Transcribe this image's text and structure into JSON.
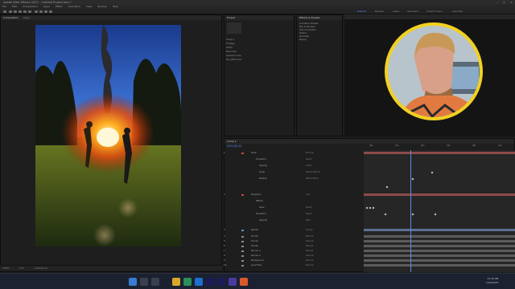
{
  "window": {
    "title": "Adobe After Effects 2023 - Untitled Project.aep *"
  },
  "menu": [
    "File",
    "Edit",
    "Composition",
    "Layer",
    "Effect",
    "Animation",
    "View",
    "Window",
    "Help"
  ],
  "workspaces": [
    "Default",
    "Review",
    "Learn",
    "Standard",
    "Small Screen",
    "Libraries"
  ],
  "comp_panel": {
    "tab": "Composition",
    "tab2": "Layer",
    "zoom": "100%",
    "resolution": "Full",
    "timecode": "0;00;04;12"
  },
  "project_panel": {
    "tab": "Project",
    "items": [
      "Comp 1",
      "Footage",
      "Solids",
      "Precomps",
      "explosion.mov",
      "fire_effect.mov"
    ]
  },
  "effects_panel": {
    "tab": "Effects & Presets",
    "items": [
      "Animation Presets",
      "Blur & Sharpen",
      "Color Correction",
      "Distort",
      "Generate",
      "Keying"
    ]
  },
  "timeline": {
    "tab": "Comp 1",
    "timecode": "0;00;04;12",
    "ruler": [
      "00s",
      "02s",
      "04s",
      "06s",
      "08s",
      "10s"
    ],
    "layers": [
      {
        "n": "1",
        "name": "Glow",
        "mode": "Normal",
        "color": "#c24a4a"
      },
      {
        "n": "",
        "name": "Transform",
        "mode": "Reset",
        "color": ""
      },
      {
        "n": "",
        "name": "Opacity",
        "mode": "100%",
        "color": ""
      },
      {
        "n": "",
        "name": "Scale",
        "mode": "100.0,100.0%",
        "color": ""
      },
      {
        "n": "",
        "name": "Position",
        "mode": "960.0,540.0",
        "color": ""
      },
      {
        "n": "2",
        "name": "Explosion",
        "mode": "Add",
        "color": "#c24a4a"
      },
      {
        "n": "",
        "name": "Effects",
        "mode": "",
        "color": ""
      },
      {
        "n": "",
        "name": "Glow",
        "mode": "Reset",
        "color": ""
      },
      {
        "n": "",
        "name": "Transform",
        "mode": "Reset",
        "color": ""
      },
      {
        "n": "",
        "name": "Opacity",
        "mode": "85%",
        "color": ""
      },
      {
        "n": "3",
        "name": "Sparks",
        "mode": "Screen",
        "color": "#6d8fc4"
      },
      {
        "n": "4",
        "name": "Fire 01",
        "mode": "Normal",
        "color": "#8a8a8a"
      },
      {
        "n": "5",
        "name": "Fire 02",
        "mode": "Normal",
        "color": "#8a8a8a"
      },
      {
        "n": "6",
        "name": "Smoke",
        "mode": "Normal",
        "color": "#8a8a8a"
      },
      {
        "n": "7",
        "name": "Runner 1",
        "mode": "Normal",
        "color": "#8a8a8a"
      },
      {
        "n": "8",
        "name": "Runner 2",
        "mode": "Normal",
        "color": "#8a8a8a"
      },
      {
        "n": "9",
        "name": "Background",
        "mode": "Normal",
        "color": "#8a8a8a"
      },
      {
        "n": "10",
        "name": "Lens Flare",
        "mode": "Normal",
        "color": "#8a8a8a"
      }
    ]
  },
  "taskbar": {
    "time": "12:42 PM",
    "date": "1/25/2023"
  },
  "colors": {
    "accent": "#5a8ef0",
    "ring": "#f2d020",
    "layer_red": "#c24a4a",
    "layer_gray": "#8a8a8a"
  }
}
